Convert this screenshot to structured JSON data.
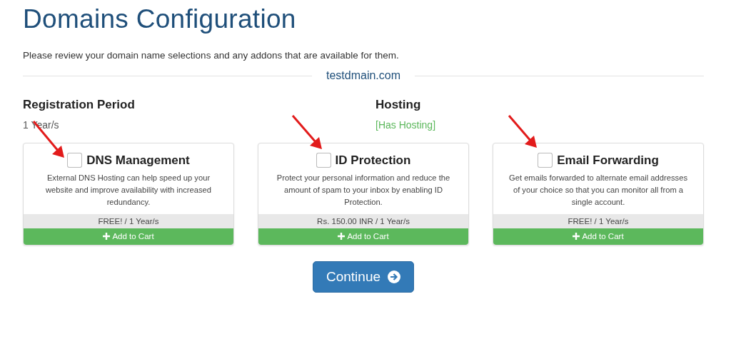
{
  "title": "Domains Configuration",
  "intro": "Please review your domain name selections and any addons that are available for them.",
  "domain": "testdmain.com",
  "registration": {
    "label": "Registration Period",
    "value": "1 Year/s"
  },
  "hosting": {
    "label": "Hosting",
    "value": "[Has Hosting]"
  },
  "addons": [
    {
      "name": "DNS Management",
      "description": "External DNS Hosting can help speed up your website and improve availability with increased redundancy.",
      "price": "FREE! / 1 Year/s",
      "button": "Add to Cart",
      "checked": false
    },
    {
      "name": "ID Protection",
      "description": "Protect your personal information and reduce the amount of spam to your inbox by enabling ID Protection.",
      "price": "Rs. 150.00 INR / 1 Year/s",
      "button": "Add to Cart",
      "checked": false
    },
    {
      "name": "Email Forwarding",
      "description": "Get emails forwarded to alternate email addresses of your choice so that you can monitor all from a single account.",
      "price": "FREE! / 1 Year/s",
      "button": "Add to Cart",
      "checked": false
    }
  ],
  "continue_button": "Continue"
}
